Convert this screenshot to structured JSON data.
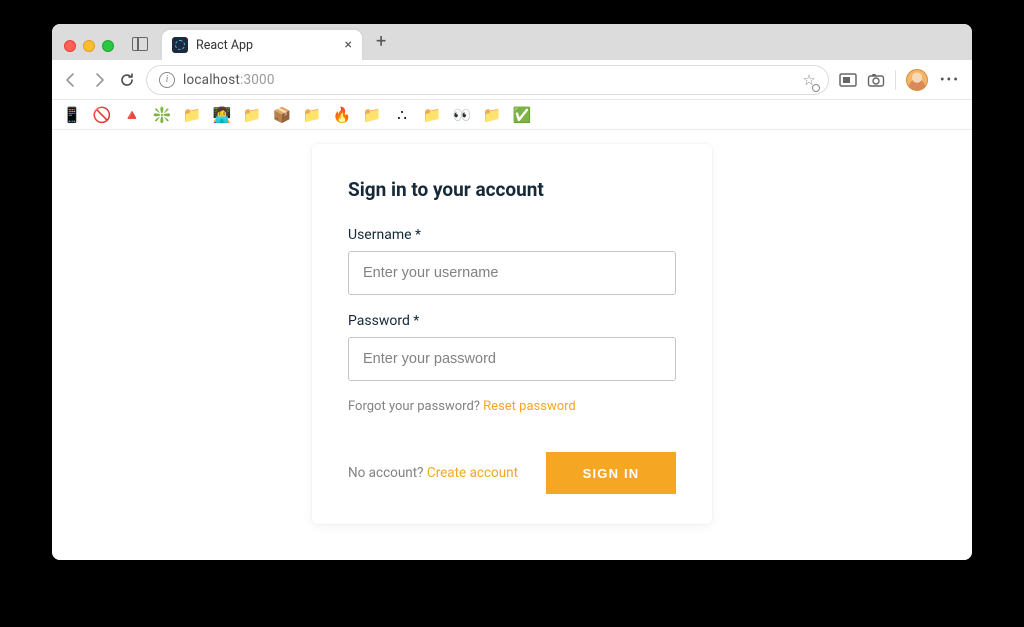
{
  "browser": {
    "tab": {
      "title": "React App"
    },
    "address": {
      "host": "localhost",
      "port": ":3000"
    },
    "bookmarks": [
      "📱",
      "🚫",
      "🔺",
      "❇️",
      "📁",
      "👩‍💻",
      "📁",
      "📦",
      "📁",
      "🔥",
      "📁",
      "∴",
      "📁",
      "👀",
      "📁",
      "✅"
    ]
  },
  "auth": {
    "heading": "Sign in to your account",
    "username": {
      "label": "Username *",
      "placeholder": "Enter your username"
    },
    "password": {
      "label": "Password *",
      "placeholder": "Enter your password"
    },
    "forgot": {
      "text": "Forgot your password? ",
      "link": "Reset password"
    },
    "no_account": {
      "text": "No account? ",
      "link": "Create account"
    },
    "submit": "SIGN IN"
  }
}
